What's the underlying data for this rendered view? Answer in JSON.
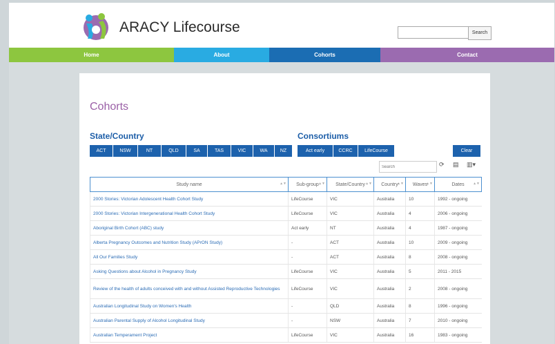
{
  "site": {
    "brand": "ARACY Lifecourse"
  },
  "search": {
    "placeholder": "",
    "button": "Search"
  },
  "nav": [
    {
      "label": "Home",
      "color": "#8dc63f"
    },
    {
      "label": "About",
      "color": "#29abe2"
    },
    {
      "label": "Cohorts",
      "color": "#1b6db3"
    },
    {
      "label": "Contact",
      "color": "#9b6bb0"
    }
  ],
  "page": {
    "title": "Cohorts"
  },
  "filters": {
    "state_title": "State/Country",
    "states": [
      "ACT",
      "NSW",
      "NT",
      "QLD",
      "SA",
      "TAS",
      "VIC",
      "WA",
      "NZ"
    ],
    "consortiums_title": "Consortiums",
    "consortiums": [
      "Act early",
      "CCRC",
      "LifeCourse"
    ],
    "clear": "Clear"
  },
  "table_tools": {
    "search_placeholder": "Search"
  },
  "table": {
    "headers": [
      "Study name",
      "Sub-group",
      "State/Country",
      "Country",
      "Waves",
      "Dates"
    ],
    "rows": [
      [
        "2000 Stories: Victorian Adolescent Health Cohort Study",
        "LifeCourse",
        "VIC",
        "Australia",
        "10",
        "1992 - ongoing"
      ],
      [
        "2000 Stories: Victorian Intergenerational Health Cohort Study",
        "LifeCourse",
        "VIC",
        "Australia",
        "4",
        "2006 - ongoing"
      ],
      [
        "Aboriginal Birth Cohort (ABC) study",
        "Act early",
        "NT",
        "Australia",
        "4",
        "1987 - ongoing"
      ],
      [
        "Alberta Pregnancy Outcomes and Nutrition Study (APrON Study)",
        "-",
        "ACT",
        "Australia",
        "10",
        "2009 - ongoing"
      ],
      [
        "All Our Families Study",
        "-",
        "ACT",
        "Australia",
        "8",
        "2008 - ongoing"
      ],
      [
        "Asking Questions about Alcohol in Pregnancy Study",
        "LifeCourse",
        "VIC",
        "Australia",
        "5",
        "2011 - 2015"
      ],
      [
        "Review of the health of adults conceived with and without Assisted Reproductive Technologies",
        "LifeCourse",
        "VIC",
        "Australia",
        "2",
        "2008 - ongoing"
      ],
      [
        "Australian Longitudinal Study on Women's Health",
        "-",
        "QLD",
        "Australia",
        "8",
        "1996 - ongoing"
      ],
      [
        "Australian Parental Supply of Alcohol Longitudinal Study",
        "-",
        "NSW",
        "Australia",
        "7",
        "2010 - ongoing"
      ],
      [
        "Australian Temperament Project",
        "LifeCourse",
        "VIC",
        "Australia",
        "16",
        "1983 - ongoing"
      ]
    ]
  }
}
